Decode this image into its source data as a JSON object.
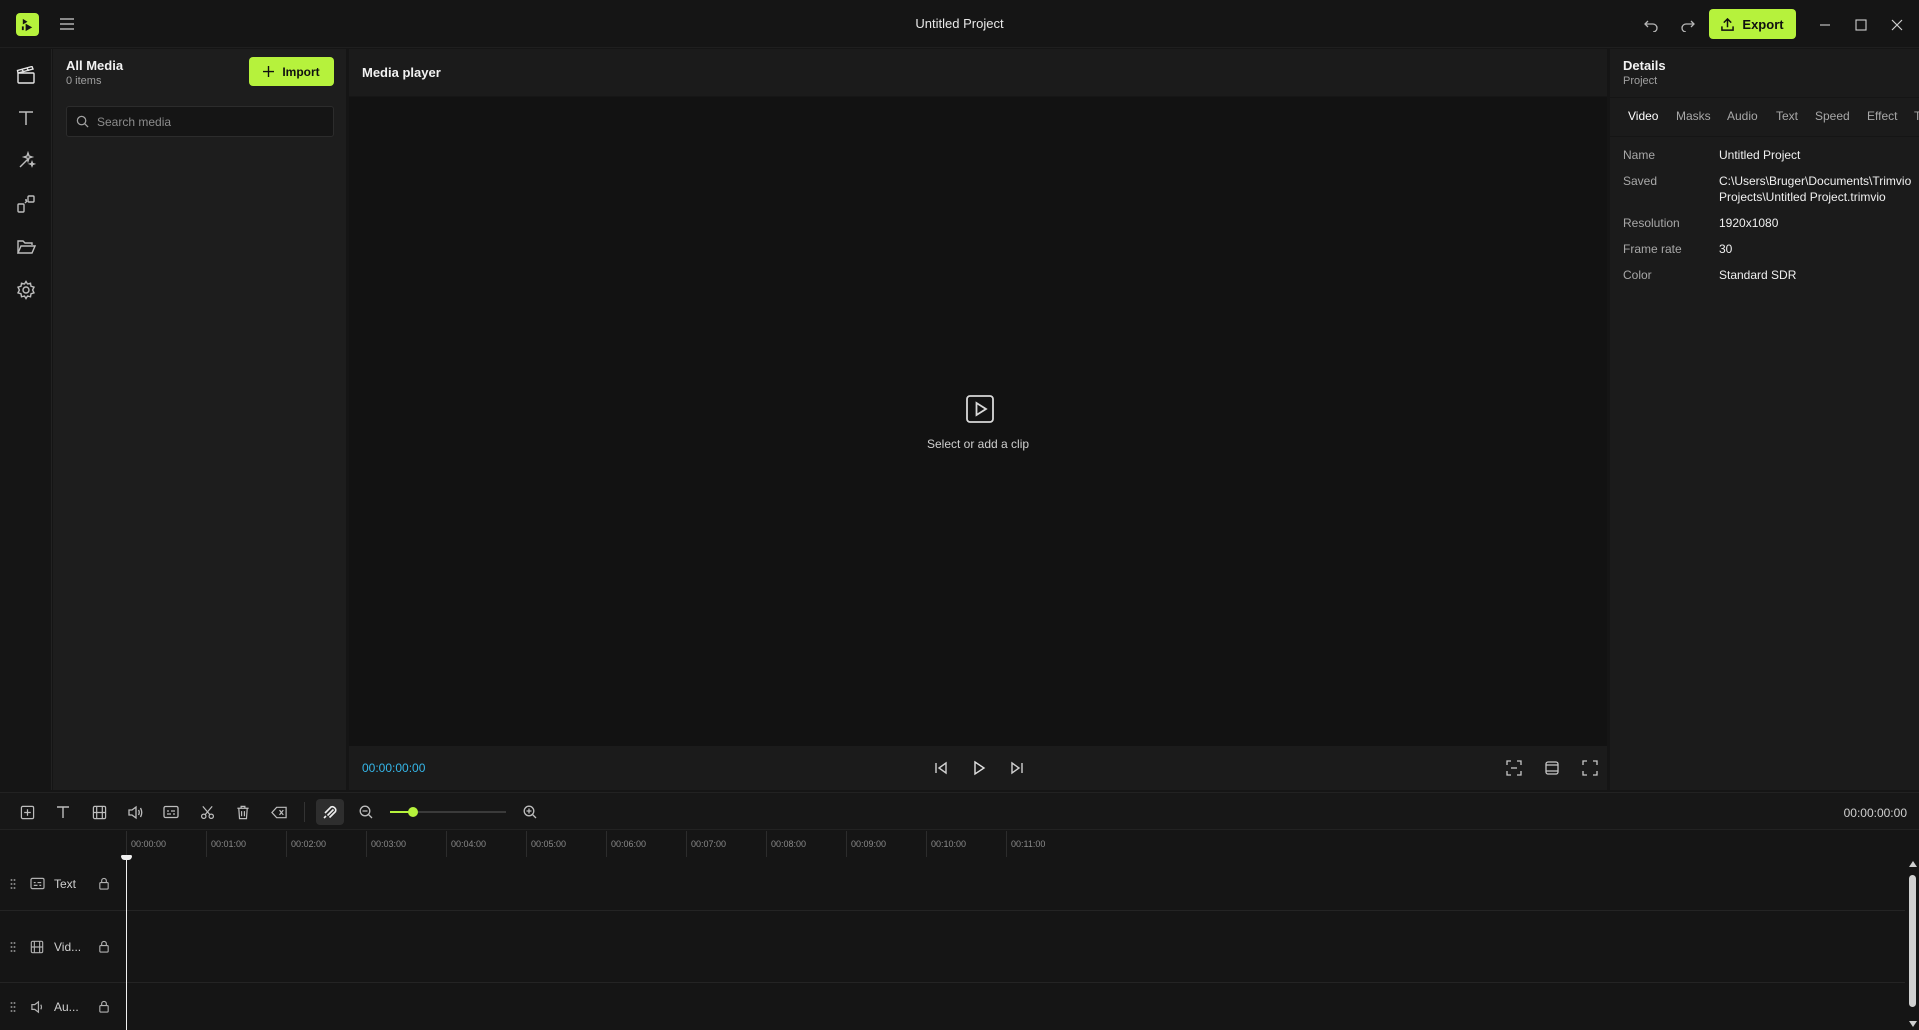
{
  "colors": {
    "accent": "#b6f23c",
    "timecode": "#35b6e8",
    "background": "#151515"
  },
  "titlebar": {
    "logo_icon": "trimvio-logo-icon",
    "menu_icon": "hamburger-menu-icon",
    "title": "Untitled Project",
    "undo_icon": "undo-icon",
    "redo_icon": "redo-icon",
    "export_label": "Export",
    "window_controls": [
      "minimize-icon",
      "maximize-icon",
      "close-icon"
    ]
  },
  "nav": {
    "items": [
      {
        "name": "media",
        "icon": "clapperboard-icon",
        "active": true
      },
      {
        "name": "text",
        "icon": "text-icon",
        "active": false
      },
      {
        "name": "effects",
        "icon": "sparkle-icon",
        "active": false
      },
      {
        "name": "transitions",
        "icon": "transition-icon",
        "active": false
      },
      {
        "name": "projects",
        "icon": "folder-open-icon",
        "active": false
      },
      {
        "name": "settings",
        "icon": "gear-icon",
        "active": false
      }
    ]
  },
  "media": {
    "title": "All Media",
    "count": "0 items",
    "import_label": "Import",
    "search_placeholder": "Search media"
  },
  "player": {
    "title": "Media player",
    "empty_text": "Select or add a clip",
    "timecode": "00:00:00:00"
  },
  "details": {
    "title": "Details",
    "subtitle": "Project",
    "tabs": [
      {
        "label": "Video",
        "active": true
      },
      {
        "label": "Masks",
        "active": false
      },
      {
        "label": "Audio",
        "active": false
      },
      {
        "label": "Text",
        "active": false
      },
      {
        "label": "Speed",
        "active": false
      },
      {
        "label": "Effect",
        "active": false
      },
      {
        "label": "T",
        "active": false
      }
    ],
    "properties": [
      {
        "label": "Name",
        "value": "Untitled Project"
      },
      {
        "label": "Saved",
        "value": "C:\\Users\\Bruger\\Documents\\Trimvio Projects\\Untitled Project.trimvio"
      },
      {
        "label": "Resolution",
        "value": "1920x1080"
      },
      {
        "label": "Frame rate",
        "value": "30"
      },
      {
        "label": "Color",
        "value": "Standard SDR"
      }
    ]
  },
  "timeline": {
    "timecode": "00:00:00:00",
    "zoom_level": 0.2,
    "ruler": [
      "00:00:00",
      "00:01:00",
      "00:02:00",
      "00:03:00",
      "00:04:00",
      "00:05:00",
      "00:06:00",
      "00:07:00",
      "00:08:00",
      "00:09:00",
      "00:10:00",
      "00:11:00"
    ],
    "tracks": [
      {
        "name": "Text",
        "icon": "caption-icon"
      },
      {
        "name": "Vid...",
        "icon": "film-icon"
      },
      {
        "name": "Au...",
        "icon": "speaker-icon"
      }
    ]
  }
}
